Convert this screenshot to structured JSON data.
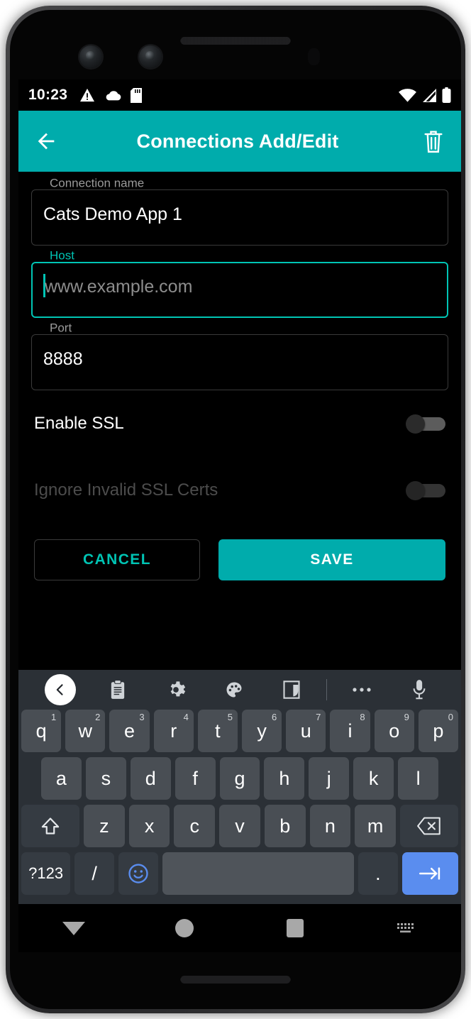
{
  "status_bar": {
    "time": "10:23",
    "left_icons": [
      "warning-icon",
      "cloud-icon",
      "sd-card-icon"
    ],
    "right_icons": [
      "wifi-icon",
      "cellular-signal-icon",
      "battery-icon"
    ]
  },
  "app_bar": {
    "title": "Connections Add/Edit",
    "back_icon": "back-arrow-icon",
    "delete_icon": "trash-icon",
    "background_color": "#00ACAC"
  },
  "form": {
    "fields": [
      {
        "label": "Connection name",
        "value": "Cats Demo App 1",
        "placeholder": "",
        "focused": false
      },
      {
        "label": "Host",
        "value": "",
        "placeholder": "www.example.com",
        "focused": true
      },
      {
        "label": "Port",
        "value": "8888",
        "placeholder": "",
        "focused": false
      }
    ]
  },
  "switches": [
    {
      "label": "Enable SSL",
      "on": false,
      "disabled": false
    },
    {
      "label": "Ignore Invalid SSL Certs",
      "on": false,
      "disabled": true
    }
  ],
  "buttons": {
    "cancel_label": "CANCEL",
    "save_label": "SAVE",
    "accent_color": "#00ACAC",
    "cancel_text_color": "#00C4B4"
  },
  "keyboard": {
    "toolbar": [
      "back-chevron-icon",
      "clipboard-icon",
      "gear-icon",
      "palette-icon",
      "one-handed-mode-icon",
      "divider",
      "more-options-icon",
      "microphone-icon"
    ],
    "row1": [
      {
        "key": "q",
        "sup": "1"
      },
      {
        "key": "w",
        "sup": "2"
      },
      {
        "key": "e",
        "sup": "3"
      },
      {
        "key": "r",
        "sup": "4"
      },
      {
        "key": "t",
        "sup": "5"
      },
      {
        "key": "y",
        "sup": "6"
      },
      {
        "key": "u",
        "sup": "7"
      },
      {
        "key": "i",
        "sup": "8"
      },
      {
        "key": "o",
        "sup": "9"
      },
      {
        "key": "p",
        "sup": "0"
      }
    ],
    "row2": [
      "a",
      "s",
      "d",
      "f",
      "g",
      "h",
      "j",
      "k",
      "l"
    ],
    "row3_letters": [
      "z",
      "x",
      "c",
      "v",
      "b",
      "n",
      "m"
    ],
    "shift_icon": "shift-up-arrow-icon",
    "backspace_icon": "backspace-icon",
    "row4": {
      "numsym_label": "?123",
      "slash_label": "/",
      "emoji_icon": "emoji-smiley-icon",
      "space_label": "",
      "period_label": ".",
      "enter_icon": "tab-next-arrow-icon"
    }
  },
  "nav_bar": {
    "back_icon": "dismiss-keyboard-triangle-icon",
    "home_icon": "home-circle-icon",
    "recents_icon": "recents-square-icon",
    "keyboard_switch_icon": "keyboard-switcher-icon"
  }
}
